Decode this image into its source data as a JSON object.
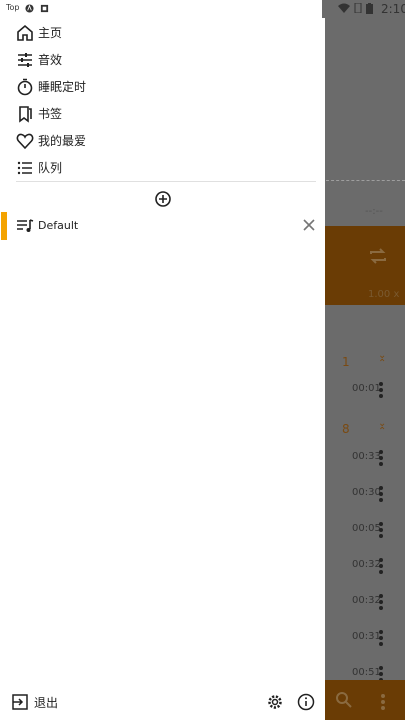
{
  "status_bar": {
    "carrier": "Top",
    "time": "2:10"
  },
  "drawer": {
    "nav_items": [
      {
        "label": "主页",
        "icon": "home-icon"
      },
      {
        "label": "音效",
        "icon": "equalizer-icon"
      },
      {
        "label": "睡眠定时",
        "icon": "timer-icon"
      },
      {
        "label": "书签",
        "icon": "bookmark-icon"
      },
      {
        "label": "我的最爱",
        "icon": "heart-icon"
      },
      {
        "label": "队列",
        "icon": "queue-list-icon"
      }
    ],
    "playlists": [
      {
        "label": "Default"
      }
    ],
    "footer": {
      "exit_label": "退出"
    }
  },
  "player": {
    "time_placeholder": "--:--",
    "speed": "1.00 x",
    "chapters": [
      {
        "number": "1"
      },
      {
        "number": "8"
      }
    ],
    "tracks": [
      "00:01",
      "00:33",
      "00:30",
      "00:05",
      "00:32",
      "00:32",
      "00:31",
      "00:51"
    ]
  },
  "colors": {
    "accent": "#f4a300",
    "player_dim": "#6b6b6b",
    "card_dim": "#6a3c05"
  }
}
